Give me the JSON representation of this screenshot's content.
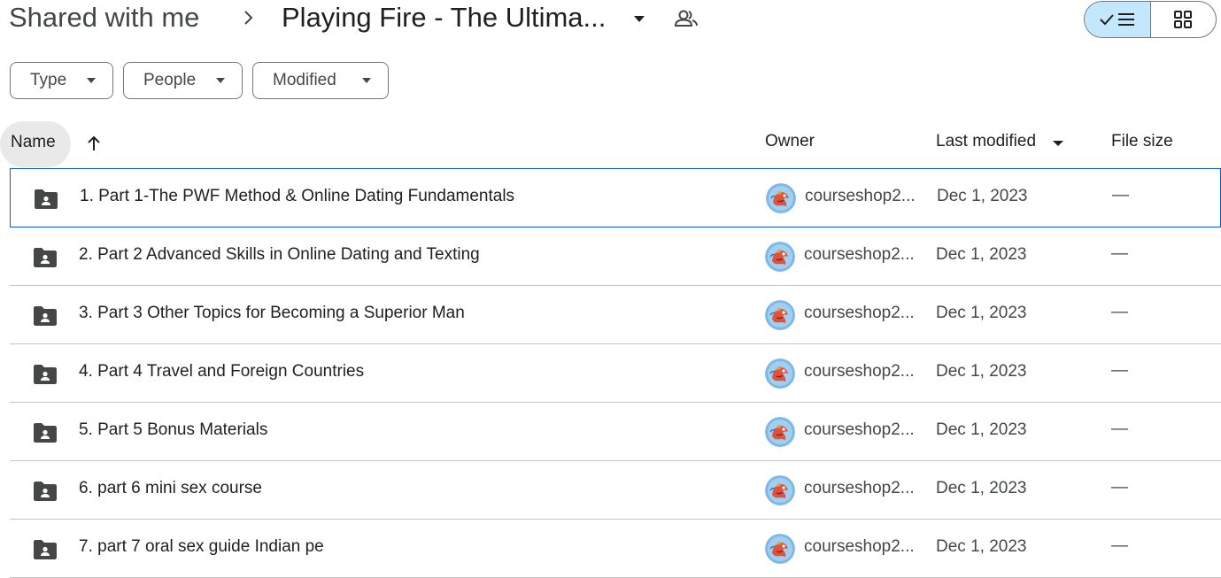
{
  "breadcrumb": {
    "root": "Shared with me",
    "folder": "Playing Fire - The Ultima..."
  },
  "icons": {
    "separator": "chevron-right-icon",
    "folder_menu": "caret-down-icon",
    "shared": "people-icon",
    "list_view": "check-list-icon",
    "grid_view": "grid-icon",
    "row_folder": "shared-folder-icon",
    "owner_avatar": "avatar-image"
  },
  "colors": {
    "accent_selected": "#c2e7ff",
    "selection_border": "#0b57d0"
  },
  "filters": {
    "type": "Type",
    "people": "People",
    "modified": "Modified"
  },
  "columns": {
    "name": "Name",
    "owner": "Owner",
    "last_modified": "Last modified",
    "file_size": "File size"
  },
  "files": [
    {
      "name": "1. Part 1-The PWF Method & Online Dating Fundamentals",
      "owner": "courseshop2...",
      "modified": "Dec 1, 2023",
      "size": "—"
    },
    {
      "name": "2. Part 2 Advanced Skills in Online Dating and Texting",
      "owner": "courseshop2...",
      "modified": "Dec 1, 2023",
      "size": "—"
    },
    {
      "name": "3. Part 3 Other Topics for Becoming a Superior Man",
      "owner": "courseshop2...",
      "modified": "Dec 1, 2023",
      "size": "—"
    },
    {
      "name": "4. Part 4 Travel and Foreign Countries",
      "owner": "courseshop2...",
      "modified": "Dec 1, 2023",
      "size": "—"
    },
    {
      "name": "5. Part 5 Bonus Materials",
      "owner": "courseshop2...",
      "modified": "Dec 1, 2023",
      "size": "—"
    },
    {
      "name": "6. part 6 mini sex course",
      "owner": "courseshop2...",
      "modified": "Dec 1, 2023",
      "size": "—"
    },
    {
      "name": "7. part 7 oral sex guide Indian pe",
      "owner": "courseshop2...",
      "modified": "Dec 1, 2023",
      "size": "—"
    }
  ]
}
